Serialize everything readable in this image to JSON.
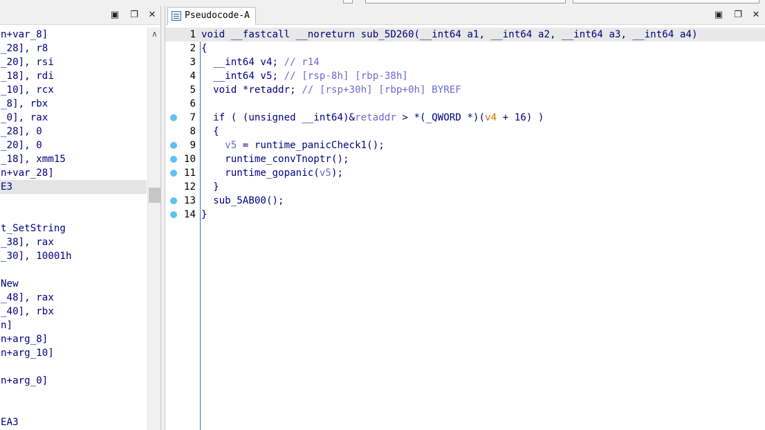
{
  "left_panel": {
    "lines": [
      {
        "text": "n+var_8]"
      },
      {
        "text": "_28], r8"
      },
      {
        "text": "_20], rsi"
      },
      {
        "text": "_18], rdi"
      },
      {
        "text": "_10], rcx"
      },
      {
        "text": "_8], rbx"
      },
      {
        "text": "_0], rax"
      },
      {
        "text": "_28], 0"
      },
      {
        "text": "_20], 0"
      },
      {
        "text": "_18], xmm15"
      },
      {
        "text": "n+var_28]"
      },
      {
        "text": "E3"
      },
      {
        "text": ""
      },
      {
        "text": ""
      },
      {
        "text": "t_SetString"
      },
      {
        "text": "_38], rax"
      },
      {
        "text": "_30], 10001h"
      },
      {
        "text": ""
      },
      {
        "text": "New"
      },
      {
        "text": "_48], rax"
      },
      {
        "text": "_40], rbx"
      },
      {
        "text": "n]"
      },
      {
        "text": "n+arg_8]"
      },
      {
        "text": "n+arg_10]"
      },
      {
        "text": ""
      },
      {
        "text": "n+arg_0]"
      },
      {
        "text": ""
      },
      {
        "text": ""
      },
      {
        "text": "EA3"
      }
    ]
  },
  "right_panel": {
    "tab_title": "Pseudocode-A",
    "lines": [
      {
        "no": "1",
        "bp": false,
        "parts": [
          [
            "kw",
            "void __fastcall __noreturn sub_5D260(__int64 a1, __int64 a2, __int64 a3, __int64 a4)"
          ]
        ]
      },
      {
        "no": "2",
        "bp": false,
        "parts": [
          [
            "kw",
            "{"
          ]
        ]
      },
      {
        "no": "3",
        "bp": false,
        "parts": [
          [
            "kw",
            "  __int64 v4; "
          ],
          [
            "cm",
            "// r14"
          ]
        ]
      },
      {
        "no": "4",
        "bp": false,
        "parts": [
          [
            "kw",
            "  __int64 v5; "
          ],
          [
            "cm",
            "// [rsp-8h] [rbp-38h]"
          ]
        ]
      },
      {
        "no": "5",
        "bp": false,
        "parts": [
          [
            "kw",
            "  void *retaddr; "
          ],
          [
            "cm",
            "// [rsp+30h] [rbp+0h] BYREF"
          ]
        ]
      },
      {
        "no": "6",
        "bp": false,
        "parts": [
          [
            "kw",
            ""
          ]
        ]
      },
      {
        "no": "7",
        "bp": true,
        "parts": [
          [
            "kw",
            "  if ( (unsigned __int64)&"
          ],
          [
            "var",
            "retaddr"
          ],
          [
            "kw",
            " > *(_QWORD *)("
          ],
          [
            "var2",
            "v4"
          ],
          [
            "kw",
            " + 16) )"
          ]
        ]
      },
      {
        "no": "8",
        "bp": false,
        "parts": [
          [
            "kw",
            "  {"
          ]
        ]
      },
      {
        "no": "9",
        "bp": true,
        "parts": [
          [
            "kw",
            "    "
          ],
          [
            "var",
            "v5"
          ],
          [
            "kw",
            " = runtime_panicCheck1();"
          ]
        ]
      },
      {
        "no": "10",
        "bp": true,
        "parts": [
          [
            "kw",
            "    runtime_convTnoptr();"
          ]
        ]
      },
      {
        "no": "11",
        "bp": true,
        "parts": [
          [
            "kw",
            "    runtime_gopanic("
          ],
          [
            "var",
            "v5"
          ],
          [
            "kw",
            ");"
          ]
        ]
      },
      {
        "no": "12",
        "bp": false,
        "parts": [
          [
            "kw",
            "  }"
          ]
        ]
      },
      {
        "no": "13",
        "bp": true,
        "parts": [
          [
            "kw",
            "  sub_5AB00();"
          ]
        ]
      },
      {
        "no": "14",
        "bp": true,
        "parts": [
          [
            "kw",
            "}"
          ]
        ]
      }
    ]
  },
  "icons": {
    "maximize": "maximize-icon",
    "restore": "restore-icon",
    "close": "close-icon",
    "scroll_up": "scroll-up-icon"
  },
  "colors": {
    "keyword": "#000080",
    "comment": "#6a6ad0",
    "breakpoint": "#5fc1f0",
    "highlight": "#e8e8e8"
  }
}
